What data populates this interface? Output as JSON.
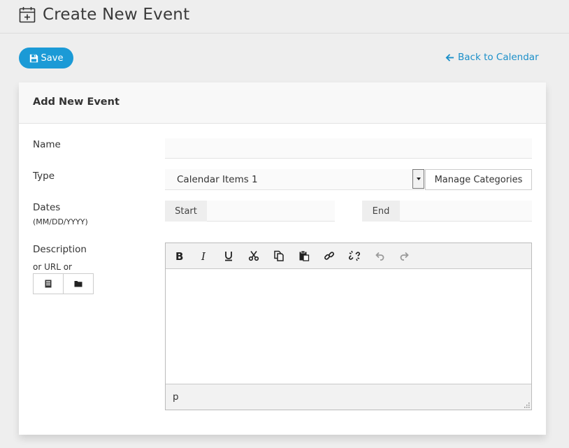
{
  "header": {
    "title": "Create New Event",
    "icon": "calendar-plus-icon"
  },
  "actions": {
    "save_label": "Save",
    "back_label": "Back to Calendar"
  },
  "panel": {
    "title": "Add New Event"
  },
  "form": {
    "name_label": "Name",
    "name_value": "",
    "type_label": "Type",
    "type_selected": "Calendar Items 1",
    "manage_categories_label": "Manage Categories",
    "dates_label": "Dates",
    "dates_format": "(MM/DD/YYYY)",
    "start_label": "Start",
    "end_label": "End",
    "description_label": "Description",
    "or_url_label": "or URL or"
  },
  "editor": {
    "toolbar": [
      "bold",
      "italic",
      "underline",
      "cut",
      "copy",
      "paste",
      "link",
      "unlink",
      "undo",
      "redo"
    ],
    "path": "p"
  },
  "colors": {
    "accent": "#1b9ad6",
    "link": "#1b8fc9",
    "background": "#eeeeee"
  }
}
